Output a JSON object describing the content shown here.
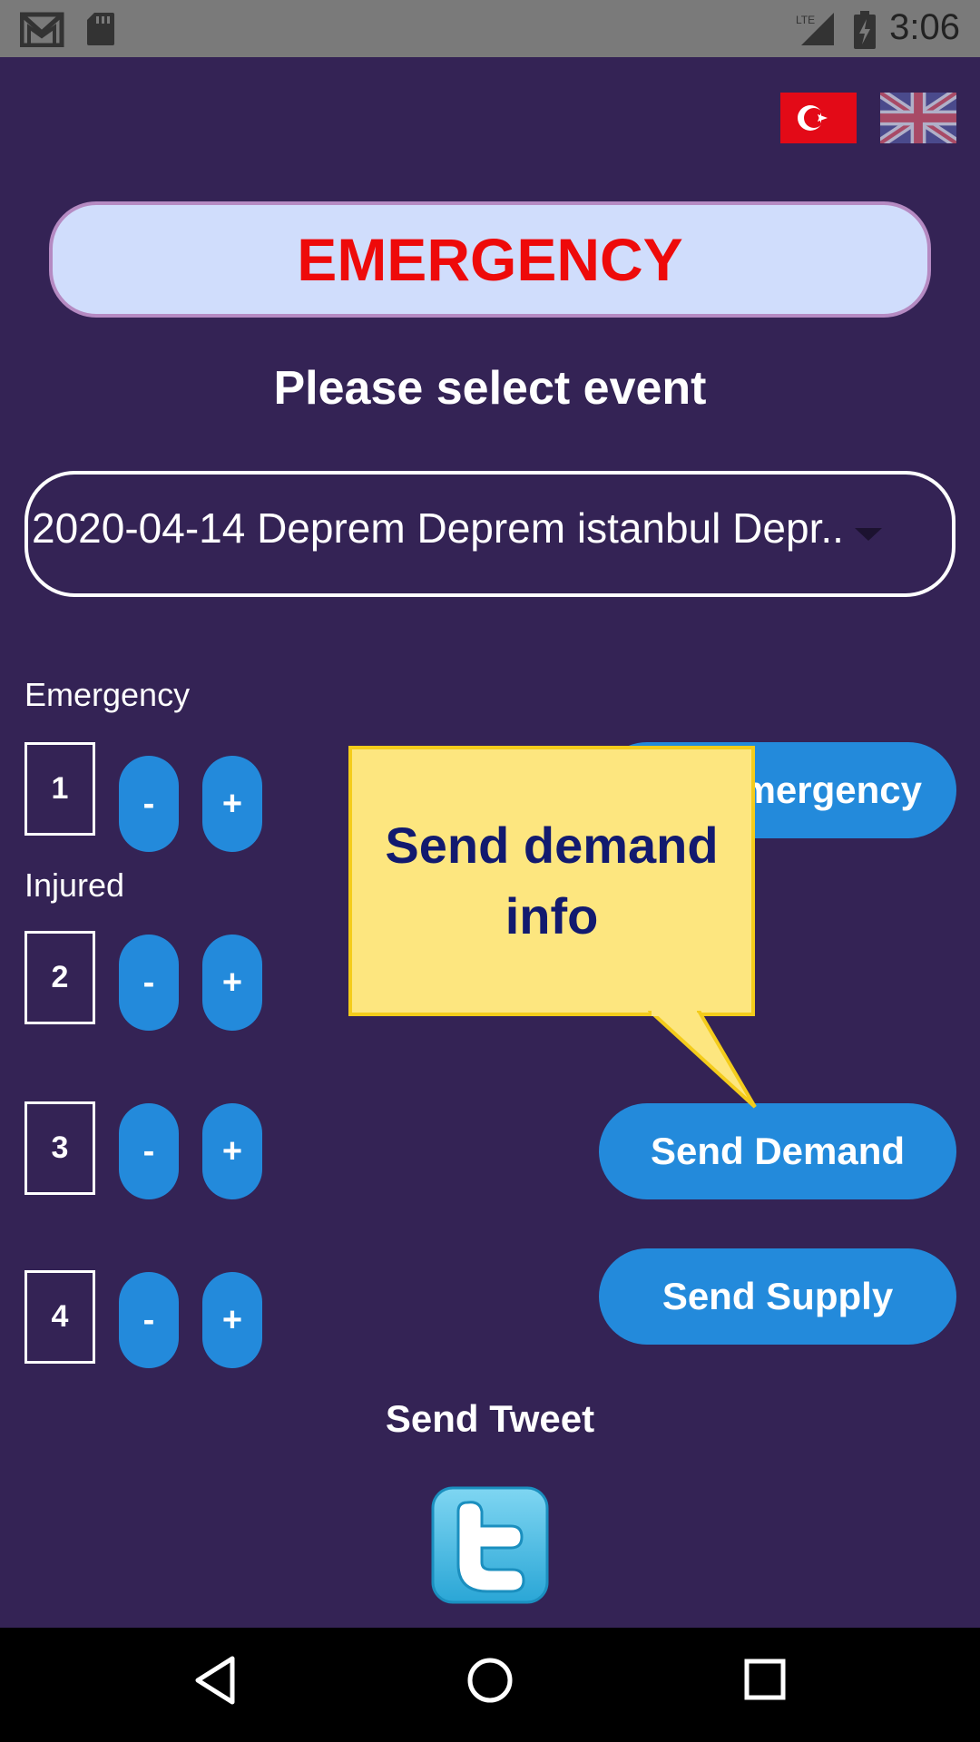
{
  "status_bar": {
    "time": "3:06",
    "network": "LTE",
    "icons": [
      "gmail-icon",
      "sd-card-icon",
      "lte-signal-icon",
      "battery-charging-icon"
    ]
  },
  "language_flags": [
    "turkey-flag",
    "uk-flag"
  ],
  "header": {
    "emergency_label": "EMERGENCY"
  },
  "event": {
    "prompt": "Please select event",
    "selected": "2020-04-14 Deprem Deprem istanbul Depr.."
  },
  "sections": {
    "emergency_label": "Emergency",
    "injured_label": "Injured"
  },
  "counters": [
    {
      "value": "1",
      "minus": "-",
      "plus": "+"
    },
    {
      "value": "2",
      "minus": "-",
      "plus": "+"
    },
    {
      "value": "3",
      "minus": "-",
      "plus": "+"
    },
    {
      "value": "4",
      "minus": "-",
      "plus": "+"
    }
  ],
  "actions": {
    "emergency_partial": "mergency",
    "send_demand": "Send Demand",
    "send_supply": "Send Supply"
  },
  "tooltip": {
    "text": "Send demand info"
  },
  "tweet": {
    "label": "Send Tweet",
    "icon": "twitter-icon"
  },
  "colors": {
    "background": "#342355",
    "accent_button": "#238adb",
    "emergency_text": "#ee0a0a",
    "tooltip_bg": "#fde67f"
  },
  "nav_bar": [
    "back-icon",
    "home-icon",
    "recents-icon"
  ]
}
